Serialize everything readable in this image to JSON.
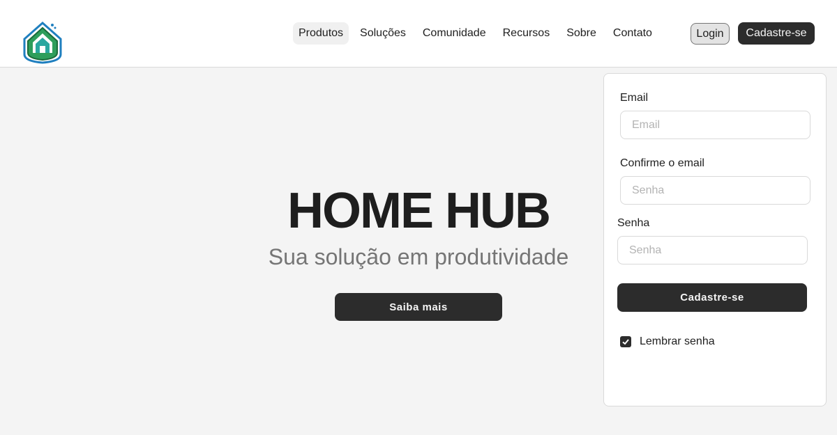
{
  "header": {
    "nav": [
      {
        "label": "Produtos",
        "active": true
      },
      {
        "label": "Soluções",
        "active": false
      },
      {
        "label": "Comunidade",
        "active": false
      },
      {
        "label": "Recursos",
        "active": false
      },
      {
        "label": "Sobre",
        "active": false
      },
      {
        "label": "Contato",
        "active": false
      }
    ],
    "login_label": "Login",
    "signup_label": "Cadastre-se"
  },
  "hero": {
    "title": "HOME HUB",
    "subtitle": "Sua solução em produtividade",
    "cta_label": "Saiba mais"
  },
  "form": {
    "email_label": "Email",
    "email_placeholder": "Email",
    "confirm_label": "Confirme o email",
    "confirm_placeholder": "Senha",
    "password_label": "Senha",
    "password_placeholder": "Senha",
    "submit_label": "Cadastre-se",
    "remember_label": "Lembrar senha",
    "remember_checked": true
  },
  "colors": {
    "primary": "#2c2c2c",
    "background": "#f4f4f4",
    "logo_blue": "#1f7fbf",
    "logo_green": "#2e9e5b"
  }
}
